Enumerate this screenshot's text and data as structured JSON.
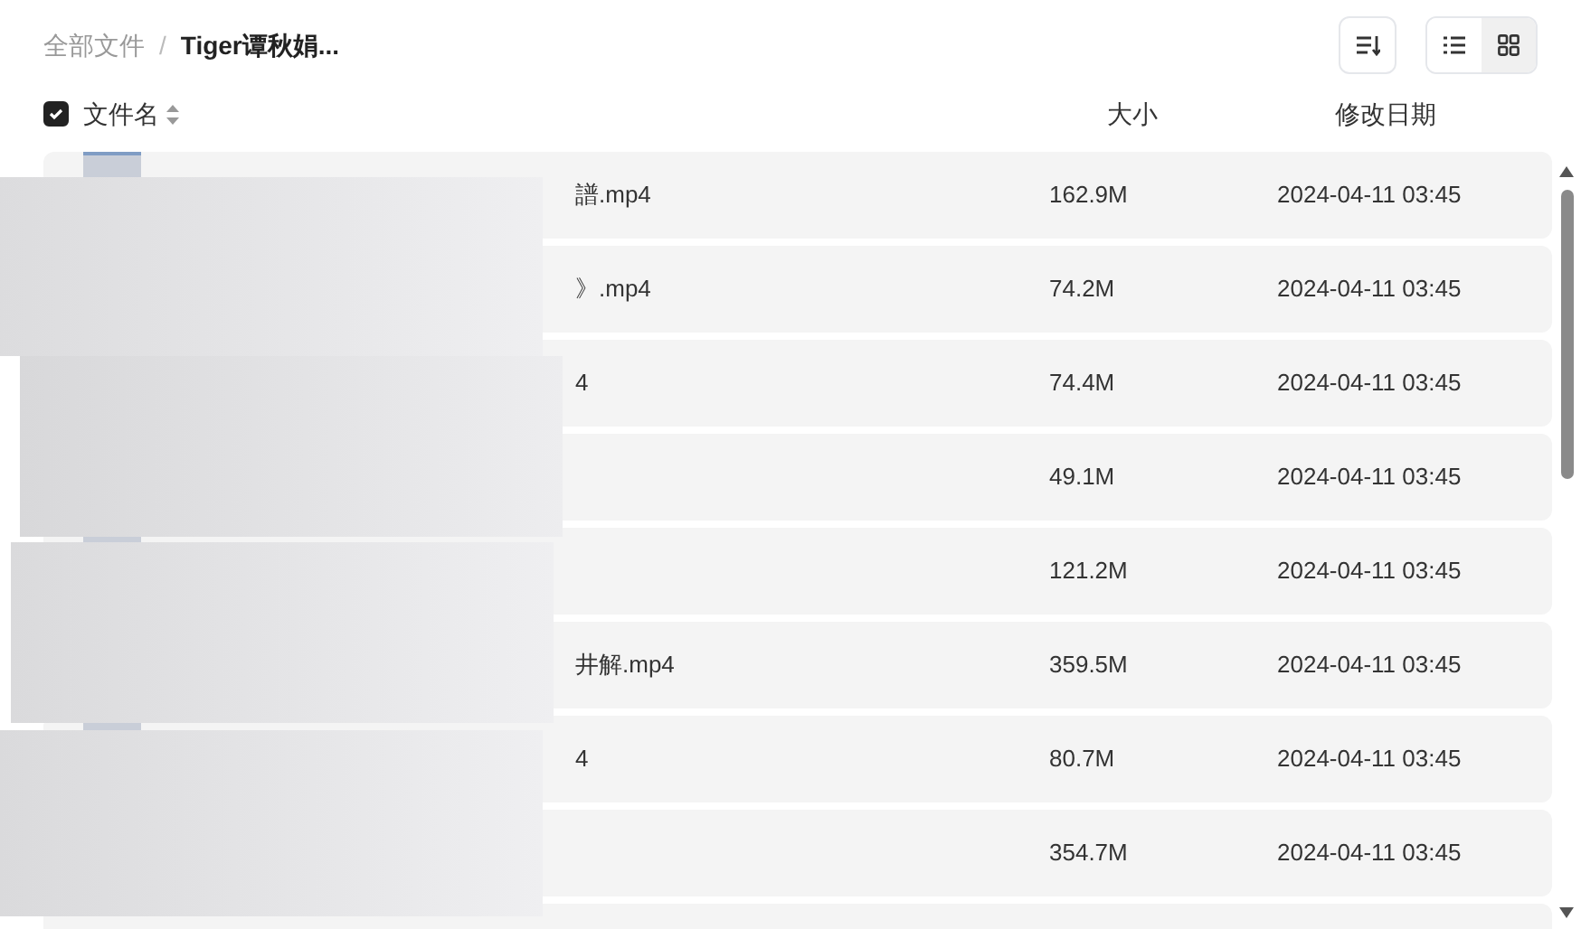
{
  "breadcrumb": [
    {
      "label": "全部文件",
      "current": false
    },
    {
      "label": "Tiger谭秋娟...",
      "current": true
    }
  ],
  "breadcrumb_separator": "/",
  "view_modes": [
    {
      "kind": "list",
      "selected": true
    },
    {
      "kind": "grid",
      "selected": false
    }
  ],
  "header": {
    "checked": true,
    "name": "文件名",
    "size": "大小",
    "date": "修改日期"
  },
  "files": [
    {
      "name": "譜.mp4",
      "size": "162.9M",
      "date": "2024-04-11 03:45"
    },
    {
      "name": "》.mp4",
      "size": "74.2M",
      "date": "2024-04-11 03:45"
    },
    {
      "name": "4",
      "size": "74.4M",
      "date": "2024-04-11 03:45"
    },
    {
      "size": "49.1M",
      "date": "2024-04-11 03:45"
    },
    {
      "size": "121.2M",
      "date": "2024-04-11 03:45"
    },
    {
      "name": "井解.mp4",
      "size": "359.5M",
      "date": "2024-04-11 03:45"
    },
    {
      "name": "4",
      "size": "80.7M",
      "date": "2024-04-11 03:45"
    },
    {
      "size": "354.7M",
      "date": "2024-04-11 03:45"
    }
  ]
}
